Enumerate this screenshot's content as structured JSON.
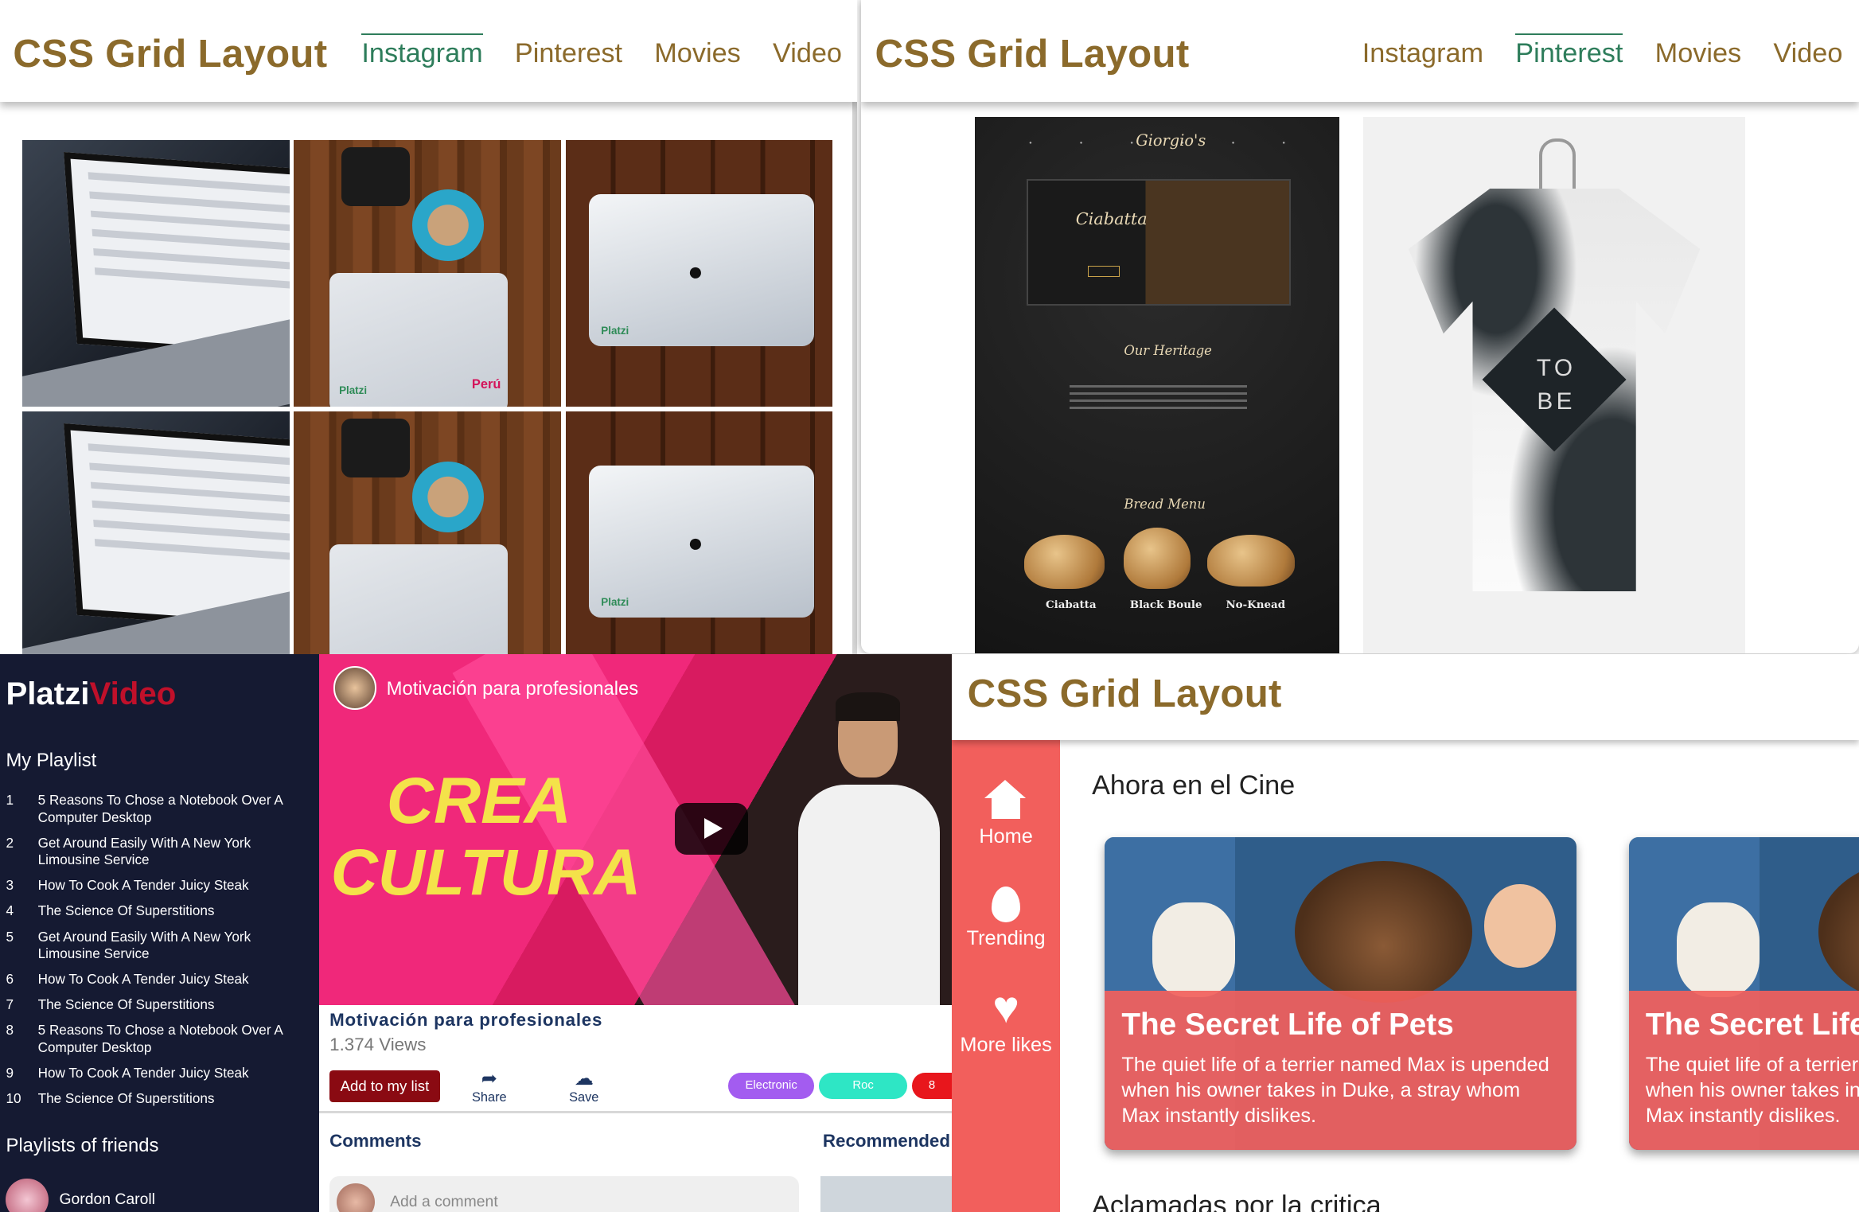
{
  "instagram_panel": {
    "logo": "CSS Grid Layout",
    "nav": [
      "Instagram",
      "Pinterest",
      "Movies",
      "Video"
    ],
    "active_nav": "Instagram",
    "photo_brand_1": "Platzi",
    "photo_brand_2": "Perú",
    "photo_brand_3": "Platzi"
  },
  "pinterest_panel": {
    "logo": "CSS Grid Layout",
    "nav": [
      "Instagram",
      "Pinterest",
      "Movies",
      "Video"
    ],
    "active_nav": "Pinterest",
    "bakery": {
      "brand": "Giorgio's",
      "hero_title": "Ciabatta",
      "heritage_title": "Our Heritage",
      "menu_title": "Bread Menu",
      "breads": [
        "Ciabatta",
        "Black Boule",
        "No-Knead"
      ]
    },
    "tshirt_text": [
      "TO",
      "BE"
    ]
  },
  "video_panel": {
    "logo_white": "Platzi",
    "logo_red": "Video",
    "my_playlist_title": "My Playlist",
    "playlist": [
      {
        "n": "1",
        "title": "5 Reasons To Chose a Notebook Over A Computer Desktop"
      },
      {
        "n": "2",
        "title": "Get Around Easily With A New York Limousine Service"
      },
      {
        "n": "3",
        "title": "How To Cook A Tender Juicy Steak"
      },
      {
        "n": "4",
        "title": "The Science Of Superstitions"
      },
      {
        "n": "5",
        "title": "Get Around Easily With A New York Limousine Service"
      },
      {
        "n": "6",
        "title": "How To Cook A Tender Juicy Steak"
      },
      {
        "n": "7",
        "title": "The Science Of Superstitions"
      },
      {
        "n": "8",
        "title": "5 Reasons To Chose a Notebook Over A Computer Desktop"
      },
      {
        "n": "9",
        "title": "How To Cook A Tender Juicy Steak"
      },
      {
        "n": "10",
        "title": "The Science Of Superstitions"
      }
    ],
    "friends_title": "Playlists of friends",
    "friend_name": "Gordon Caroll",
    "player": {
      "title": "Motivación para profesionales",
      "overlay_line1": "CREA",
      "overlay_line2": "CULTURA"
    },
    "video_title": "Motivación para profesionales",
    "views": "1.374 Views",
    "add_button": "Add to my list",
    "share_label": "Share",
    "save_label": "Save",
    "tags": [
      {
        "label": "Electronic",
        "color": "#a35cf0"
      },
      {
        "label": "Roc",
        "color": "#2ee6c5"
      },
      {
        "label": "8",
        "color": "#e8161c"
      }
    ],
    "comments_title": "Comments",
    "recommended_title": "Recommended",
    "comment_placeholder": "Add a comment"
  },
  "movies_panel": {
    "logo": "CSS Grid Layout",
    "nav": [
      {
        "label": "Home",
        "icon": "home-icon"
      },
      {
        "label": "Trending",
        "icon": "flame-icon"
      },
      {
        "label": "More likes",
        "icon": "heart-icon"
      }
    ],
    "section1": "Ahora en el Cine",
    "section2": "Aclamadas por la critica",
    "cards": [
      {
        "title": "The Secret Life of Pets",
        "desc": "The quiet life of a terrier named Max is upended when his owner takes in Duke, a stray whom Max instantly dislikes."
      },
      {
        "title": "The Secret Life of Pets",
        "desc": "The quiet life of a terrier named Max is upended when his owner takes in Duke, a stray whom Max instantly dislikes."
      }
    ],
    "accent": "#f25f5c"
  }
}
